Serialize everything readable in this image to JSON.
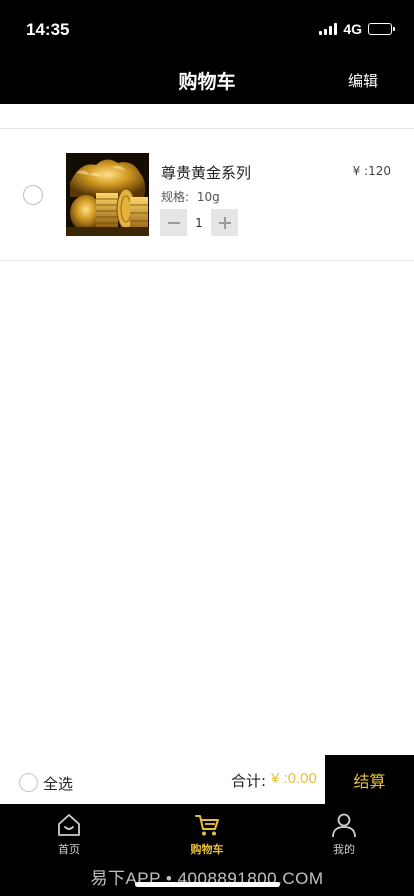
{
  "status_bar": {
    "time": "14:35",
    "network": "4G"
  },
  "header": {
    "title": "购物车",
    "edit_label": "编辑"
  },
  "cart": {
    "items": [
      {
        "name": "尊贵黄金系列",
        "price": "¥ :120",
        "spec_label": "规格:",
        "spec_value": "10g",
        "quantity": "1",
        "selected": false
      }
    ]
  },
  "footer": {
    "select_all_label": "全选",
    "total_label": "合计:",
    "total_amount": "¥ :0.00",
    "checkout_label": "结算"
  },
  "tabbar": {
    "items": [
      {
        "label": "首页",
        "icon": "home-icon",
        "active": false
      },
      {
        "label": "购物车",
        "icon": "cart-icon",
        "active": true
      },
      {
        "label": "我的",
        "icon": "user-icon",
        "active": false
      }
    ]
  },
  "watermark": "易下APP • 4008891800.COM",
  "colors": {
    "accent": "#e8bf3c",
    "bar_bg": "#000000",
    "divider": "#e6e6e6"
  }
}
